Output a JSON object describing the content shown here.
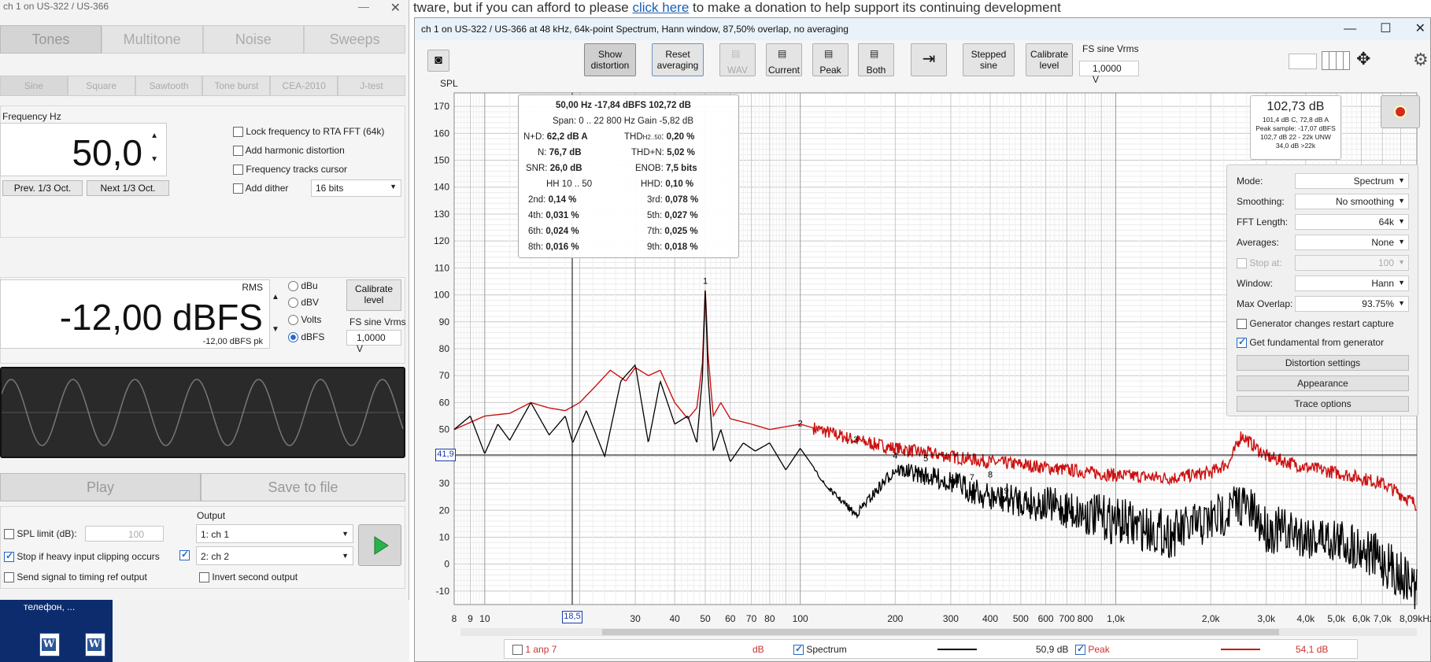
{
  "background": {
    "top_text_before": "tware, but if you can afford to please ",
    "top_link": "click here",
    "top_text_after": " to make a donation to help support its continuing development",
    "desktop_label": "телефон, ..."
  },
  "generator": {
    "title": "ch 1 on US-322 / US-366",
    "main_tabs": [
      "Tones",
      "Multitone",
      "Noise",
      "Sweeps"
    ],
    "sub_tabs": [
      "Sine",
      "Square",
      "Sawtooth",
      "Tone burst",
      "CEA-2010",
      "J-test"
    ],
    "frequency_label": "Frequency Hz",
    "frequency_value": "50,0",
    "prev_oct": "Prev. 1/3 Oct.",
    "next_oct": "Next 1/3 Oct.",
    "options": [
      {
        "label": "Lock frequency to RTA FFT (64k)",
        "checked": false
      },
      {
        "label": "Add harmonic distortion",
        "checked": false
      },
      {
        "label": "Frequency tracks cursor",
        "checked": false
      },
      {
        "label": "Add dither",
        "checked": false
      }
    ],
    "dither_bits": "16 bits",
    "level_rms_label": "RMS",
    "level_value": "-12,00 dBFS",
    "level_pk": "-12,00 dBFS pk",
    "units": [
      {
        "label": "dBu",
        "selected": false
      },
      {
        "label": "dBV",
        "selected": false
      },
      {
        "label": "Volts",
        "selected": false
      },
      {
        "label": "dBFS",
        "selected": true
      }
    ],
    "calibrate_label": "Calibrate level",
    "fs_sine_label": "FS sine Vrms",
    "fs_sine_value": "1,0000 V",
    "play_label": "Play",
    "save_label": "Save to file",
    "spl_limit_label": "SPL limit (dB):",
    "spl_limit_value": "100",
    "stop_clip_label": "Stop if heavy input clipping occurs",
    "send_timing_label": "Send signal to timing ref output",
    "output_label": "Output",
    "output_ch1": "1: ch 1",
    "output_ch2": "2: ch 2",
    "invert_label": "Invert second output"
  },
  "rta": {
    "title": "ch 1 on US-322 / US-366 at 48 kHz, 64k-point Spectrum, Hann window, 87,50% overlap, no averaging",
    "toolbar": {
      "show_distortion": "Show distortion",
      "reset_averaging": "Reset averaging",
      "wav": "WAV",
      "current": "Current",
      "peak": "Peak",
      "both": "Both",
      "stepped_sine": "Stepped sine",
      "calibrate_level": "Calibrate level",
      "fs_sine_label": "FS sine Vrms",
      "fs_sine_value": "1,0000 V"
    },
    "y_axis_label": "SPL",
    "cursor_y_value": "41,9",
    "cursor_x_value": "18,5",
    "readout": {
      "line1": "50,00 Hz  -17,84 dBFS  102,72 dB",
      "line2": "Span: 0 .. 22 800 Hz   Gain -5,82 dB",
      "nd_label": "N+D:",
      "nd_value": "62,2 dB A",
      "thd_label": "THD",
      "thd_sub": "H2..50",
      "thd_value": "0,20 %",
      "n_label": "N:",
      "n_value": "76,7 dB",
      "thdn_label": "THD+N:",
      "thdn_value": "5,02 %",
      "snr_label": "SNR:",
      "snr_value": "26,0 dB",
      "enob_label": "ENOB:",
      "enob_value": "7,5 bits",
      "hh_label": "HH 10 .. 50",
      "hhd_label": "HHD:",
      "hhd_value": "0,10 %",
      "h2_label": "2nd:",
      "h2": "0,14 %",
      "h3_label": "3rd:",
      "h3": "0,078 %",
      "h4_label": "4th:",
      "h4": "0,031 %",
      "h5_label": "5th:",
      "h5": "0,027 %",
      "h6_label": "6th:",
      "h6": "0,024 %",
      "h7_label": "7th:",
      "h7": "0,025 %",
      "h8_label": "8th:",
      "h8": "0,016 %",
      "h9_label": "9th:",
      "h9": "0,018 %"
    },
    "peak_box": {
      "value": "102,73 dB",
      "l1": "101,4 dB C, 72,8 dB A",
      "l2": "Peak sample: -17,07 dBFS",
      "l3": "102,7 dB 22 - 22k UNW",
      "l4": "34,0 dB >22k"
    },
    "side": {
      "mode_label": "Mode:",
      "mode": "Spectrum",
      "smoothing_label": "Smoothing:",
      "smoothing": "No smoothing",
      "fft_label": "FFT Length:",
      "fft": "64k",
      "averages_label": "Averages:",
      "averages": "None",
      "stop_at_label": "Stop at:",
      "stop_at": "100",
      "window_label": "Window:",
      "window": "Hann",
      "overlap_label": "Max Overlap:",
      "overlap": "93.75%",
      "gen_restart_label": "Generator changes restart capture",
      "get_fund_label": "Get fundamental from generator",
      "distortion_settings": "Distortion settings",
      "appearance": "Appearance",
      "trace_options": "Trace options"
    },
    "legend": {
      "amp": "1 anp 7",
      "unit": "dB",
      "spectrum_label": "Spectrum",
      "spectrum_value": "50,9 dB",
      "peak_label": "Peak",
      "peak_value": "54,1 dB"
    },
    "colors": {
      "current": "#000000",
      "peak": "#cc1111",
      "accent": "#2769c4"
    }
  },
  "chart_data": {
    "type": "line",
    "title": "",
    "xlabel": "",
    "ylabel": "SPL",
    "x_scale": "log",
    "xlim": [
      8,
      9000
    ],
    "ylim": [
      -15,
      175
    ],
    "y_ticks": [
      -10,
      0,
      10,
      20,
      30,
      40,
      50,
      60,
      70,
      80,
      90,
      100,
      110,
      120,
      130,
      140,
      150,
      160,
      170
    ],
    "x_ticks": [
      {
        "v": 8,
        "label": "8"
      },
      {
        "v": 9,
        "label": "9"
      },
      {
        "v": 10,
        "label": "10"
      },
      {
        "v": 30,
        "label": "30"
      },
      {
        "v": 40,
        "label": "40"
      },
      {
        "v": 50,
        "label": "50"
      },
      {
        "v": 60,
        "label": "60"
      },
      {
        "v": 70,
        "label": "70"
      },
      {
        "v": 80,
        "label": "80"
      },
      {
        "v": 100,
        "label": "100"
      },
      {
        "v": 200,
        "label": "200"
      },
      {
        "v": 300,
        "label": "300"
      },
      {
        "v": 400,
        "label": "400"
      },
      {
        "v": 500,
        "label": "500"
      },
      {
        "v": 600,
        "label": "600"
      },
      {
        "v": 700,
        "label": "700"
      },
      {
        "v": 800,
        "label": "800"
      },
      {
        "v": 1000,
        "label": "1,0k"
      },
      {
        "v": 2000,
        "label": "2,0k"
      },
      {
        "v": 3000,
        "label": "3,0k"
      },
      {
        "v": 4000,
        "label": "4,0k"
      },
      {
        "v": 5000,
        "label": "5,0k"
      },
      {
        "v": 6000,
        "label": "6,0k"
      },
      {
        "v": 7000,
        "label": "7,0k"
      },
      {
        "v": 9000,
        "label": "8,09kHz"
      }
    ],
    "grid": true,
    "series": [
      {
        "name": "Spectrum",
        "color": "#000000",
        "x": [
          8,
          9,
          10,
          11,
          12,
          14,
          16,
          18,
          19,
          21,
          24,
          27,
          30,
          33,
          36,
          40,
          44,
          47,
          49,
          50,
          51,
          53,
          56,
          60,
          66,
          72,
          80,
          90,
          100,
          120,
          150,
          200,
          300,
          400,
          500,
          700,
          1000,
          1500,
          2000,
          2500,
          3000,
          4000,
          5000,
          6000,
          7000,
          8000,
          9000
        ],
        "y": [
          50,
          55,
          41,
          52,
          46,
          60,
          48,
          55,
          45,
          57,
          40,
          68,
          74,
          45,
          68,
          52,
          55,
          45,
          70,
          103,
          70,
          42,
          50,
          38,
          45,
          42,
          45,
          35,
          43,
          30,
          20,
          38,
          35,
          30,
          30,
          28,
          25,
          20,
          25,
          32,
          22,
          20,
          18,
          15,
          10,
          5,
          0
        ]
      },
      {
        "name": "Peak",
        "color": "#cc1111",
        "x": [
          8,
          10,
          12,
          14,
          16,
          18,
          20,
          22,
          25,
          28,
          30,
          33,
          36,
          40,
          44,
          47,
          49,
          50,
          51,
          53,
          56,
          60,
          70,
          80,
          100,
          150,
          200,
          300,
          400,
          500,
          700,
          1000,
          1500,
          2000,
          2300,
          2500,
          3000,
          4000,
          5000,
          6000,
          7000,
          8000,
          9000
        ],
        "y": [
          50,
          55,
          56,
          60,
          58,
          57,
          60,
          65,
          72,
          68,
          73,
          70,
          72,
          60,
          54,
          58,
          75,
          103,
          78,
          55,
          60,
          54,
          52,
          50,
          52,
          46,
          43,
          40,
          38,
          37,
          35,
          33,
          32,
          34,
          38,
          48,
          40,
          36,
          34,
          32,
          30,
          26,
          22
        ]
      }
    ],
    "markers": [
      {
        "label": "1",
        "x": 50,
        "y": 103
      },
      {
        "label": "2",
        "x": 100,
        "y": 50
      },
      {
        "label": "3",
        "x": 150,
        "y": 44
      },
      {
        "label": "4",
        "x": 200,
        "y": 38
      },
      {
        "label": "5",
        "x": 250,
        "y": 37
      },
      {
        "label": "6",
        "x": 300,
        "y": 29
      },
      {
        "label": "7",
        "x": 350,
        "y": 30
      },
      {
        "label": "8",
        "x": 400,
        "y": 31
      },
      {
        "label": "9",
        "x": 450,
        "y": 25
      }
    ]
  }
}
